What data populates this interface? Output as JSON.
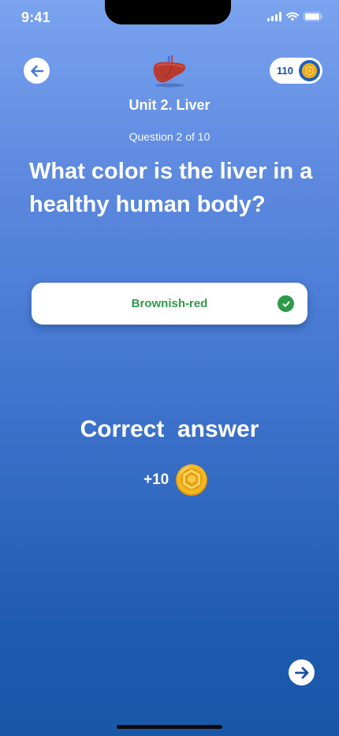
{
  "status_bar": {
    "time": "9:41"
  },
  "header": {
    "unit_title": "Unit 2. Liver",
    "coin_balance": "110",
    "question_counter": "Question 2 of 10"
  },
  "question": {
    "text": "What color is the liver in a healthy human body?"
  },
  "answer": {
    "label": "Brownish-red",
    "state": "correct"
  },
  "result": {
    "title": "Correct  answer",
    "reward": "+10"
  },
  "colors": {
    "correct_green": "#2e9a48",
    "coin_gold": "#f2b41c",
    "primary_blue": "#1f5fb8"
  },
  "icons": {
    "back": "arrow-left-icon",
    "next": "arrow-right-icon",
    "unit": "liver-icon",
    "currency": "coin-icon",
    "status": "check-icon"
  }
}
